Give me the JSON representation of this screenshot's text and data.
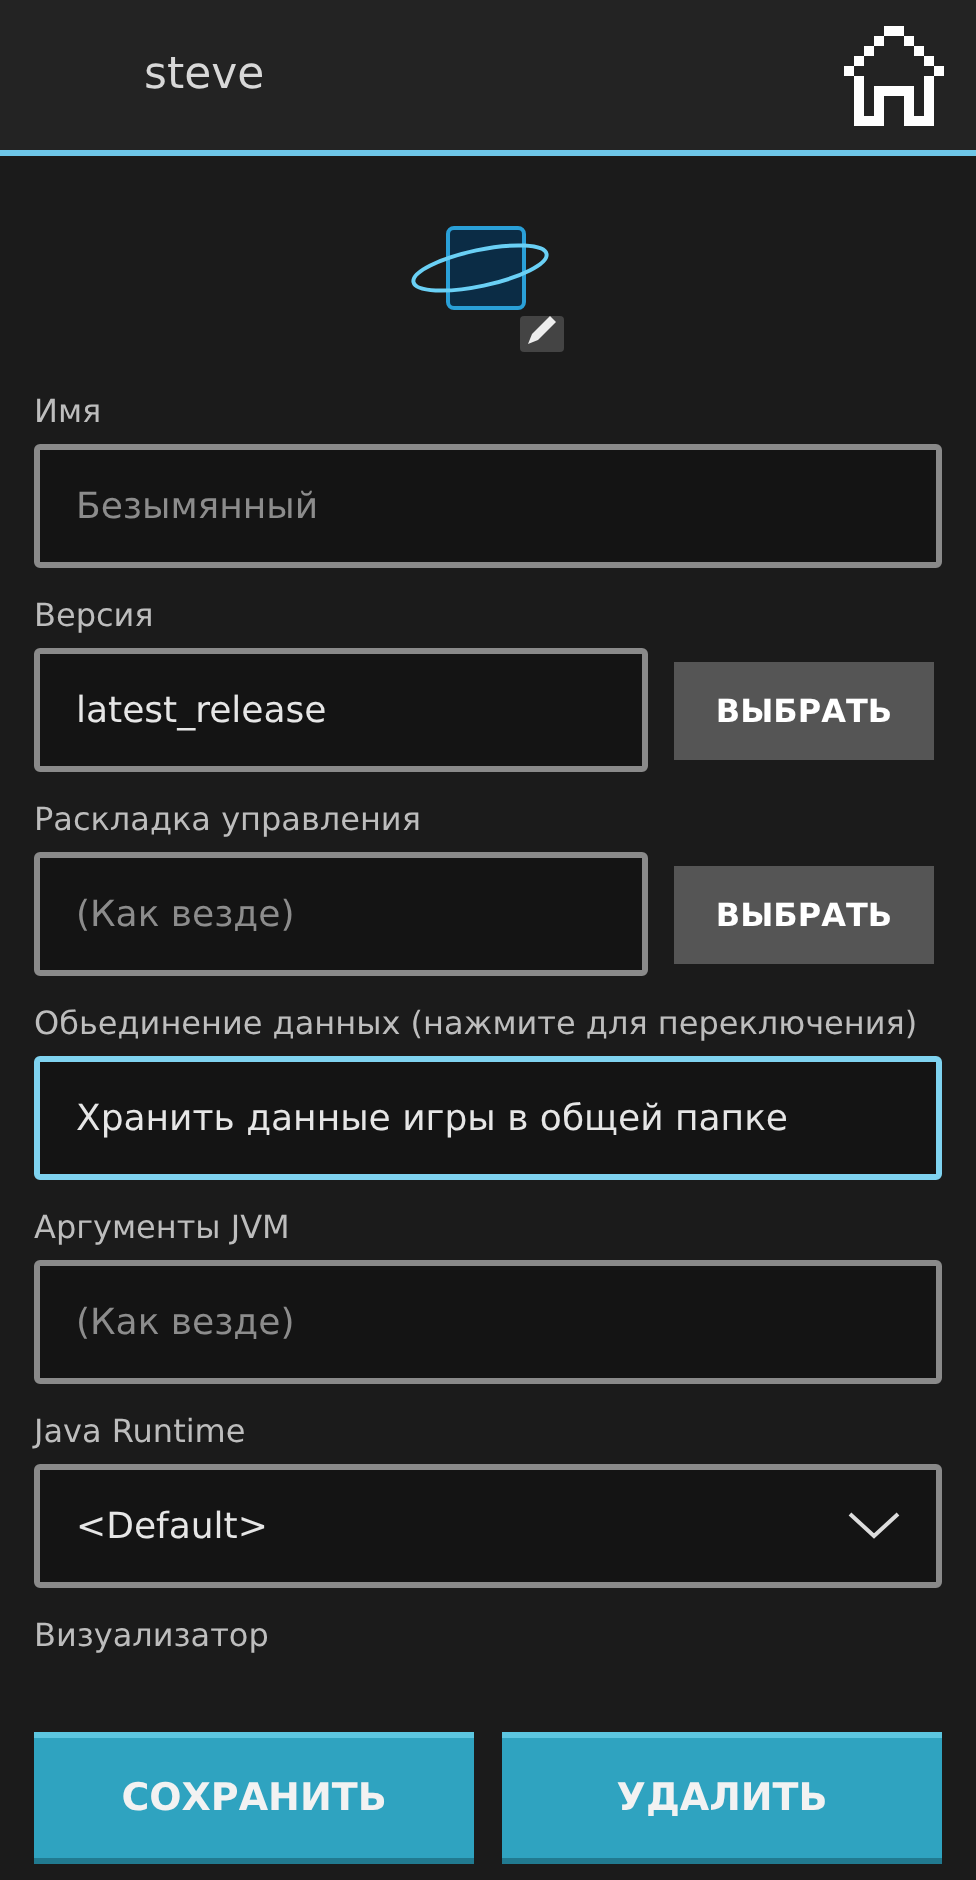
{
  "header": {
    "title": "steve"
  },
  "fields": [
    {
      "kind": "text",
      "label": "Имя",
      "placeholder": "Безымянный",
      "focused": false
    },
    {
      "kind": "text",
      "label": "Версия",
      "value": "latest_release",
      "button": "ВЫБРАТЬ",
      "focused": false
    },
    {
      "kind": "text",
      "label": "Раскладка управления",
      "placeholder": "(Как везде)",
      "button": "ВЫБРАТЬ",
      "focused": false
    },
    {
      "kind": "toggle",
      "label": "Обьединение данных (нажмите для переключения)",
      "value": "Хранить данные игры в общей папке",
      "focused": true
    },
    {
      "kind": "text",
      "label": "Аргументы JVM",
      "placeholder": "(Как везде)",
      "focused": false
    },
    {
      "kind": "dropdown",
      "label": "Java Runtime",
      "value": "<Default>",
      "focused": false
    },
    {
      "kind": "label",
      "label": "Визуализатор"
    }
  ],
  "buttons": [
    "СОХРАНИТЬ",
    "УДАЛИТЬ"
  ]
}
